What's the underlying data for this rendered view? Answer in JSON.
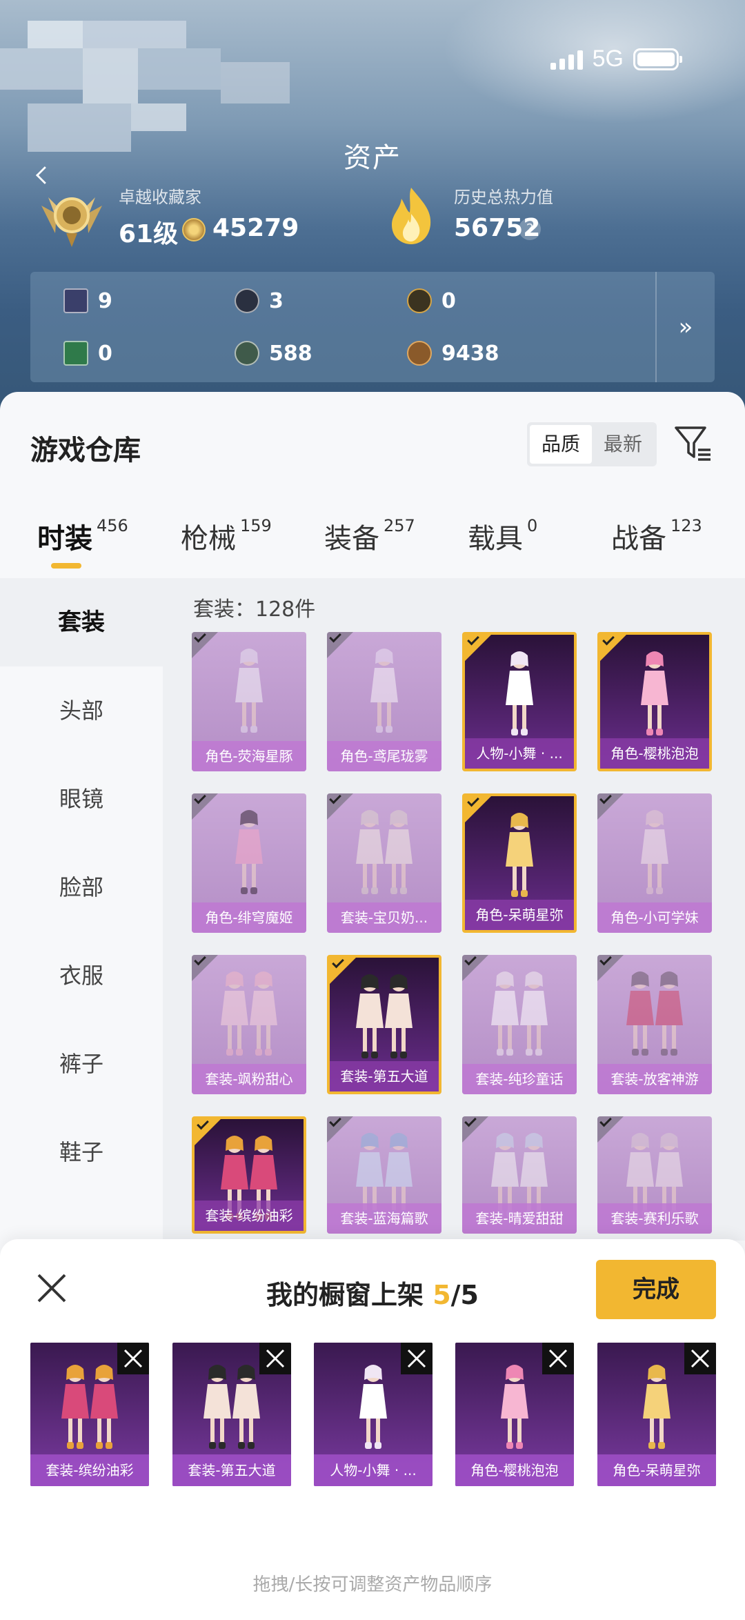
{
  "status": {
    "network": "5G"
  },
  "header": {
    "title": "资产",
    "collector_title": "卓越收藏家",
    "level": "61级",
    "coins": "45279",
    "heat_label": "历史总热力值",
    "heat_value": "56752",
    "help": "?",
    "assets": [
      "9",
      "3",
      "0",
      "0",
      "588",
      "9438"
    ],
    "more": "»"
  },
  "warehouse": {
    "title": "游戏仓库",
    "sort": [
      "品质",
      "最新"
    ],
    "tabs": [
      {
        "label": "时装",
        "count": "456"
      },
      {
        "label": "枪械",
        "count": "159"
      },
      {
        "label": "装备",
        "count": "257"
      },
      {
        "label": "载具",
        "count": "0"
      },
      {
        "label": "战备",
        "count": "123"
      }
    ],
    "sidebar": [
      "套装",
      "头部",
      "眼镜",
      "脸部",
      "衣服",
      "裤子",
      "鞋子"
    ],
    "count_line": "套装：128件",
    "items": [
      {
        "name": "角色-荧海星豚",
        "selected": false
      },
      {
        "name": "角色-鸢尾珑雾",
        "selected": false
      },
      {
        "name": "人物-小舞 · ...",
        "selected": true
      },
      {
        "name": "角色-樱桃泡泡",
        "selected": true
      },
      {
        "name": "角色-绯穹魔姬",
        "selected": false
      },
      {
        "name": "套装-宝贝奶...",
        "selected": false
      },
      {
        "name": "角色-呆萌星弥",
        "selected": true
      },
      {
        "name": "角色-小可学妹",
        "selected": false
      },
      {
        "name": "套装-飒粉甜心",
        "selected": false
      },
      {
        "name": "套装-第五大道",
        "selected": true
      },
      {
        "name": "套装-纯珍童话",
        "selected": false
      },
      {
        "name": "套装-放客神游",
        "selected": false
      },
      {
        "name": "套装-缤纷油彩",
        "selected": true
      },
      {
        "name": "套装-蓝海篇歌",
        "selected": false
      },
      {
        "name": "套装-晴爱甜甜",
        "selected": false
      },
      {
        "name": "套装-赛利乐歌",
        "selected": false
      }
    ]
  },
  "shelf": {
    "title_prefix": "我的橱窗上架 ",
    "title_count": "5",
    "title_total": "/5",
    "done": "完成",
    "items": [
      "套装-缤纷油彩",
      "套装-第五大道",
      "人物-小舞 · ...",
      "角色-樱桃泡泡",
      "角色-呆萌星弥"
    ],
    "hint": "拖拽/长按可调整资产物品顺序"
  },
  "colors": {
    "accent": "#f2b731",
    "purple": "#6b2e8e"
  }
}
